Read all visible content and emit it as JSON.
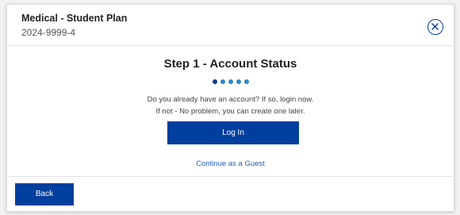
{
  "header": {
    "plan_title": "Medical - Student Plan",
    "plan_id": "2024-9999-4",
    "close_icon": "close-circle-icon"
  },
  "step": {
    "title": "Step 1 - Account Status",
    "total_steps": 5,
    "current_step": 1,
    "message_line1": "Do you already have an account? If so, login now.",
    "message_line2": "If not - No problem, you can create one later.",
    "login_label": "Log In",
    "guest_label": "Continue as a Guest"
  },
  "footer": {
    "back_label": "Back"
  },
  "colors": {
    "primary": "#003f9e",
    "dot_active": "#0b3d91",
    "dot_inactive": "#2a88c8",
    "link": "#1a5cb8"
  }
}
